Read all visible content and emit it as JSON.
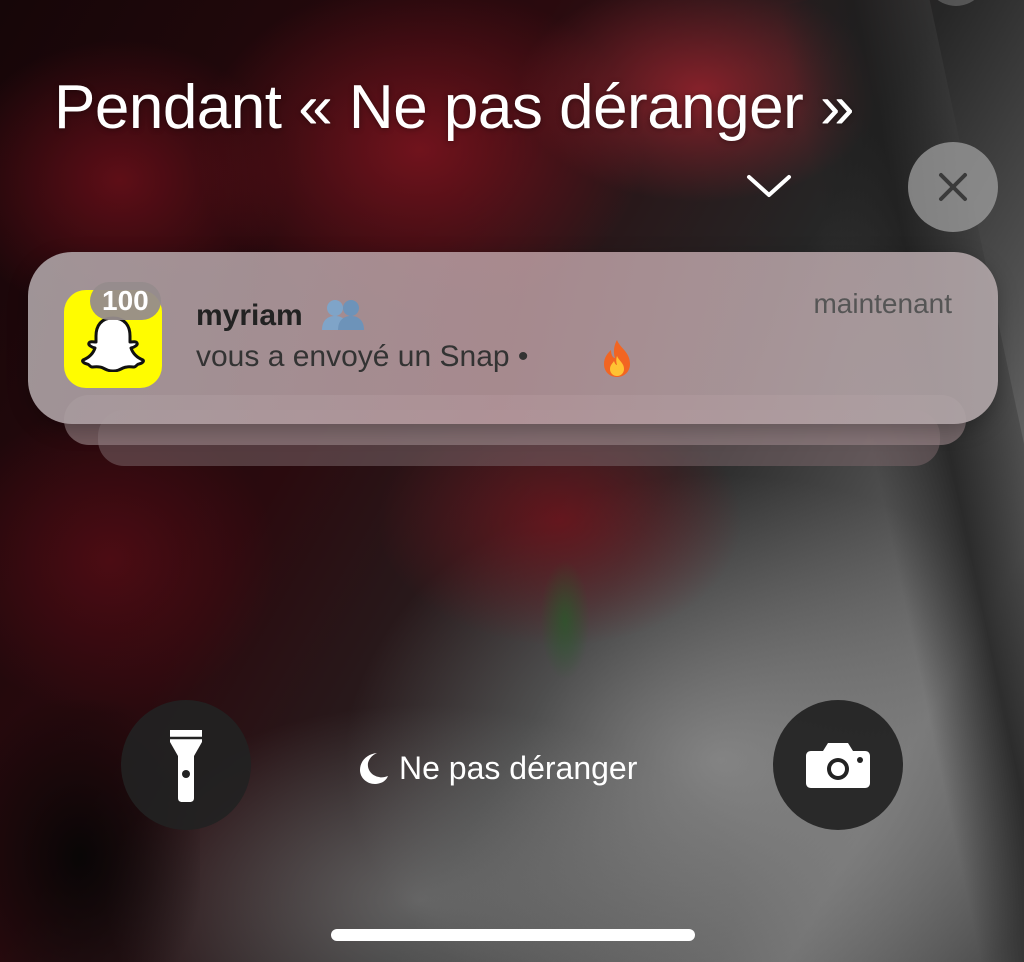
{
  "focus": {
    "title": "Pendant « Ne pas déranger »",
    "status_label": "Ne pas déranger"
  },
  "notification": {
    "app_icon": "snapchat-ghost-icon",
    "badge_count": "100",
    "sender": "myriam",
    "sender_emoji": "friends-icon",
    "timestamp": "maintenant",
    "message": "vous a envoyé un Snap •",
    "message_emoji": "fire-icon",
    "stacked_more": true
  },
  "controls": {
    "flashlight_icon": "flashlight-icon",
    "camera_icon": "camera-icon",
    "close_icon": "close-icon",
    "collapse_icon": "chevron-down-icon"
  },
  "colors": {
    "snapchat_yellow": "#FFFC00",
    "button_dark": "#222222"
  }
}
